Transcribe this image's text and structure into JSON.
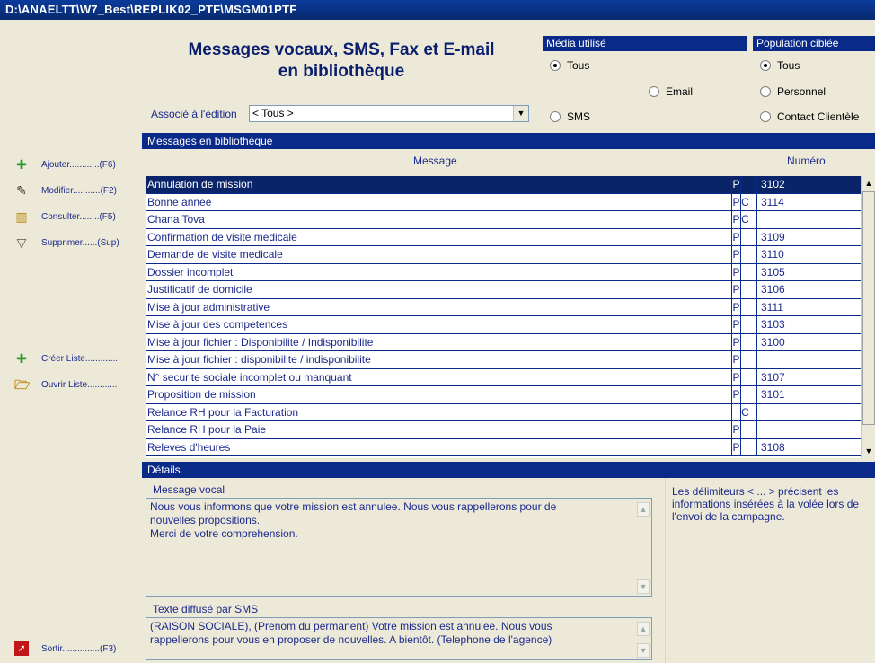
{
  "window": {
    "title": "D:\\ANAELTT\\W7_Best\\REPLIK02_PTF\\MSGM01PTF"
  },
  "header": {
    "title_line1": "Messages vocaux, SMS, Fax et E-mail",
    "title_line2": "en bibliothèque",
    "assoc_label": "Associé à l'édition",
    "assoc_value": "< Tous >"
  },
  "media": {
    "label": "Média utilisé",
    "options": [
      {
        "label": "Tous",
        "selected": true
      },
      {
        "label": "Email",
        "selected": false
      },
      {
        "label": "SMS",
        "selected": false
      }
    ]
  },
  "population": {
    "label": "Population ciblée",
    "options": [
      {
        "label": "Tous",
        "selected": true
      },
      {
        "label": "Personnel",
        "selected": false
      },
      {
        "label": "Contact Clientèle",
        "selected": false
      }
    ]
  },
  "sidebar": {
    "items": [
      {
        "label": "Ajouter............(F6)",
        "icon": "plus-icon"
      },
      {
        "label": "Modifier...........(F2)",
        "icon": "edit-icon"
      },
      {
        "label": "Consulter........(F5)",
        "icon": "book-icon"
      },
      {
        "label": "Supprimer......(Sup)",
        "icon": "trash-icon"
      },
      {
        "label": "Créer Liste.............",
        "icon": "plus-icon"
      },
      {
        "label": "Ouvrir Liste............",
        "icon": "folder-open-icon"
      },
      {
        "label": "Sortir...............(F3)",
        "icon": "exit-icon"
      }
    ]
  },
  "library": {
    "section_title": "Messages en bibliothèque",
    "col_message": "Message",
    "col_numero": "Numéro",
    "rows": [
      {
        "message": "Annulation de mission",
        "p": "P",
        "c": "",
        "numero": "3102",
        "selected": true
      },
      {
        "message": "Bonne annee",
        "p": "P",
        "c": "C",
        "numero": "3114"
      },
      {
        "message": "Chana Tova",
        "p": "P",
        "c": "C",
        "numero": ""
      },
      {
        "message": "Confirmation de visite medicale",
        "p": "P",
        "c": "",
        "numero": "3109"
      },
      {
        "message": "Demande de visite medicale",
        "p": "P",
        "c": "",
        "numero": "3110"
      },
      {
        "message": "Dossier incomplet",
        "p": "P",
        "c": "",
        "numero": "3105"
      },
      {
        "message": "Justificatif de domicile",
        "p": "P",
        "c": "",
        "numero": "3106"
      },
      {
        "message": "Mise à jour administrative",
        "p": "P",
        "c": "",
        "numero": "3111"
      },
      {
        "message": "Mise à jour des competences",
        "p": "P",
        "c": "",
        "numero": "3103"
      },
      {
        "message": "Mise à jour fichier : Disponibilite / Indisponibilite",
        "p": "P",
        "c": "",
        "numero": "3100"
      },
      {
        "message": "Mise à jour fichier : disponibilite / indisponibilite",
        "p": "P",
        "c": "",
        "numero": ""
      },
      {
        "message": "N° securite sociale incomplet ou manquant",
        "p": "P",
        "c": "",
        "numero": "3107"
      },
      {
        "message": "Proposition de mission",
        "p": "P",
        "c": "",
        "numero": "3101"
      },
      {
        "message": "Relance RH pour la Facturation",
        "p": "",
        "c": "C",
        "numero": ""
      },
      {
        "message": "Relance RH pour la Paie",
        "p": "P",
        "c": "",
        "numero": ""
      },
      {
        "message": "Releves d'heures",
        "p": "P",
        "c": "",
        "numero": "3108"
      }
    ]
  },
  "details": {
    "section_title": "Détails",
    "vocal_label": "Message vocal",
    "vocal_line1": "Nous vous informons que votre mission est annulee. Nous vous rappellerons pour de",
    "vocal_line2": "nouvelles propositions.",
    "vocal_line3": "Merci de votre comprehension.",
    "sms_label": "Texte diffusé par SMS",
    "sms_line1": "(RAISON SOCIALE), (Prenom du permanent) Votre mission est annulee. Nous vous",
    "sms_line2": "rappellerons pour vous en proposer de nouvelles. A bientôt.  (Telephone de l'agence)",
    "note_line1": "Les délimiteurs < ... > précisent les",
    "note_line2": "informations insérées à la volée lors de",
    "note_line3": "l'envoi de la campagne."
  },
  "colors": {
    "titlebar": "#0a3b9b",
    "section": "#0a2a8a",
    "selection": "#0a246a",
    "text": "#1c2a8c"
  }
}
